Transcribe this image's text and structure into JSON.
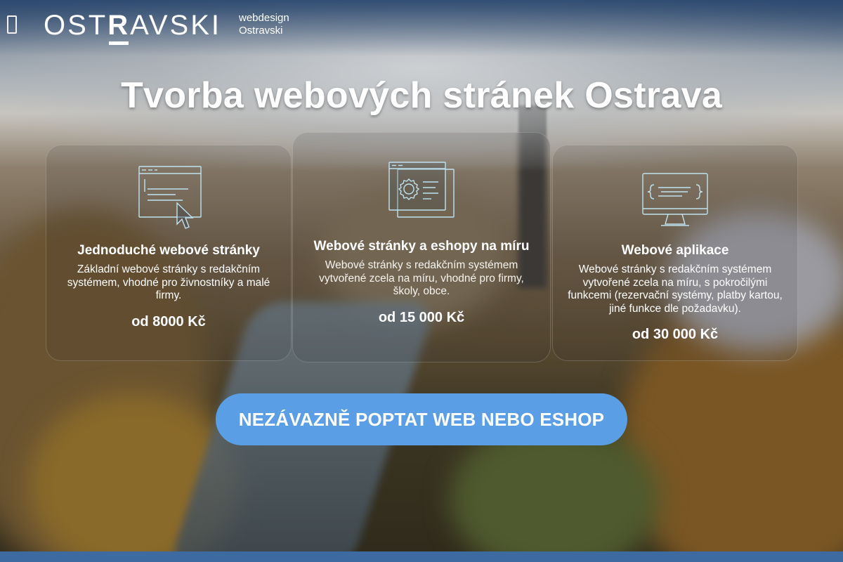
{
  "header": {
    "menu_icon": "hamburger-menu-icon",
    "logo": {
      "text_before": "OST",
      "text_highlight": "R",
      "text_after": "AVSKI"
    },
    "tagline_line1": "webdesign",
    "tagline_line2": "Ostravski"
  },
  "hero": {
    "title": "Tvorba webových stránek Ostrava"
  },
  "cards": [
    {
      "icon": "browser-cursor-icon",
      "title": "Jednoduché webové stránky",
      "description": "Základní webové stránky s redakčním systémem, vhodné pro živnostníky a malé firmy.",
      "price": "od 8000 Kč"
    },
    {
      "icon": "browser-gear-icon",
      "title": "Webové stránky a eshopy na míru",
      "description": "Webové stránky s redakčním systémem vytvořené zcela na míru, vhodné pro firmy, školy, obce.",
      "price": "od 15 000 Kč"
    },
    {
      "icon": "monitor-code-icon",
      "title": "Webové aplikace",
      "description": "Webové stránky s redakčním systémem vytvořené zcela na míru, s pokročilými funkcemi (rezervační systémy, platby kartou, jiné funkce dle požadavku).",
      "price": "od 30 000 Kč"
    }
  ],
  "cta": {
    "label": "NEZÁVAZNĚ POPTAT WEB NEBO ESHOP"
  },
  "colors": {
    "cta_background": "#5a9ee6",
    "text": "#ffffff",
    "bottom_bar": "#3d6aa0",
    "icon_stroke": "#bfe3ef"
  }
}
